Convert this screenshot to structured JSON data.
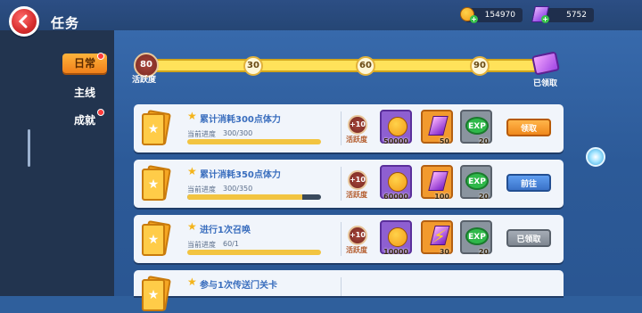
{
  "header": {
    "title": "任务"
  },
  "currency": {
    "coins": "154970",
    "gems": "5752"
  },
  "sidebar": {
    "tabs": [
      {
        "label": "日常",
        "active": true,
        "dot": true
      },
      {
        "label": "主线",
        "active": false,
        "dot": false
      },
      {
        "label": "成就",
        "active": false,
        "dot": true
      }
    ]
  },
  "activity": {
    "value": "80",
    "label": "活跃度",
    "milestones": [
      "30",
      "60",
      "90"
    ],
    "chest_label": "已领取"
  },
  "tasks": [
    {
      "title": "累计消耗300点体力",
      "progress_label": "当前进度",
      "progress_value": "300/300",
      "progress": 1.0,
      "activity_reward": "+10",
      "activity_label": "活跃度",
      "rewards": [
        {
          "type": "coin",
          "amount": "50000"
        },
        {
          "type": "gem",
          "amount": "50"
        },
        {
          "type": "exp",
          "amount": "20",
          "text": "EXP"
        }
      ],
      "button": "领取",
      "button_state": "claim"
    },
    {
      "title": "累计消耗350点体力",
      "progress_label": "当前进度",
      "progress_value": "300/350",
      "progress": 0.857,
      "activity_reward": "+10",
      "activity_label": "活跃度",
      "rewards": [
        {
          "type": "coin",
          "amount": "60000"
        },
        {
          "type": "gem",
          "amount": "100"
        },
        {
          "type": "exp",
          "amount": "20",
          "text": "EXP"
        }
      ],
      "button": "前往",
      "button_state": "go"
    },
    {
      "title": "进行1次召唤",
      "progress_label": "当前进度",
      "progress_value": "60/1",
      "progress": 1.0,
      "activity_reward": "+10",
      "activity_label": "活跃度",
      "rewards": [
        {
          "type": "coin",
          "amount": "10000"
        },
        {
          "type": "bolt",
          "amount": "30"
        },
        {
          "type": "exp",
          "amount": "20",
          "text": "EXP"
        }
      ],
      "button": "已领取",
      "button_state": "done"
    },
    {
      "title": "参与1次传送门关卡",
      "progress_label": "",
      "progress_value": "",
      "progress": 0,
      "activity_reward": "",
      "activity_label": "",
      "rewards": [],
      "button": "",
      "button_state": "none"
    }
  ],
  "colors": {
    "accent": "#f0891c",
    "go": "#3a72c8",
    "done": "#7f8791",
    "bg": "#2f5f9c"
  }
}
